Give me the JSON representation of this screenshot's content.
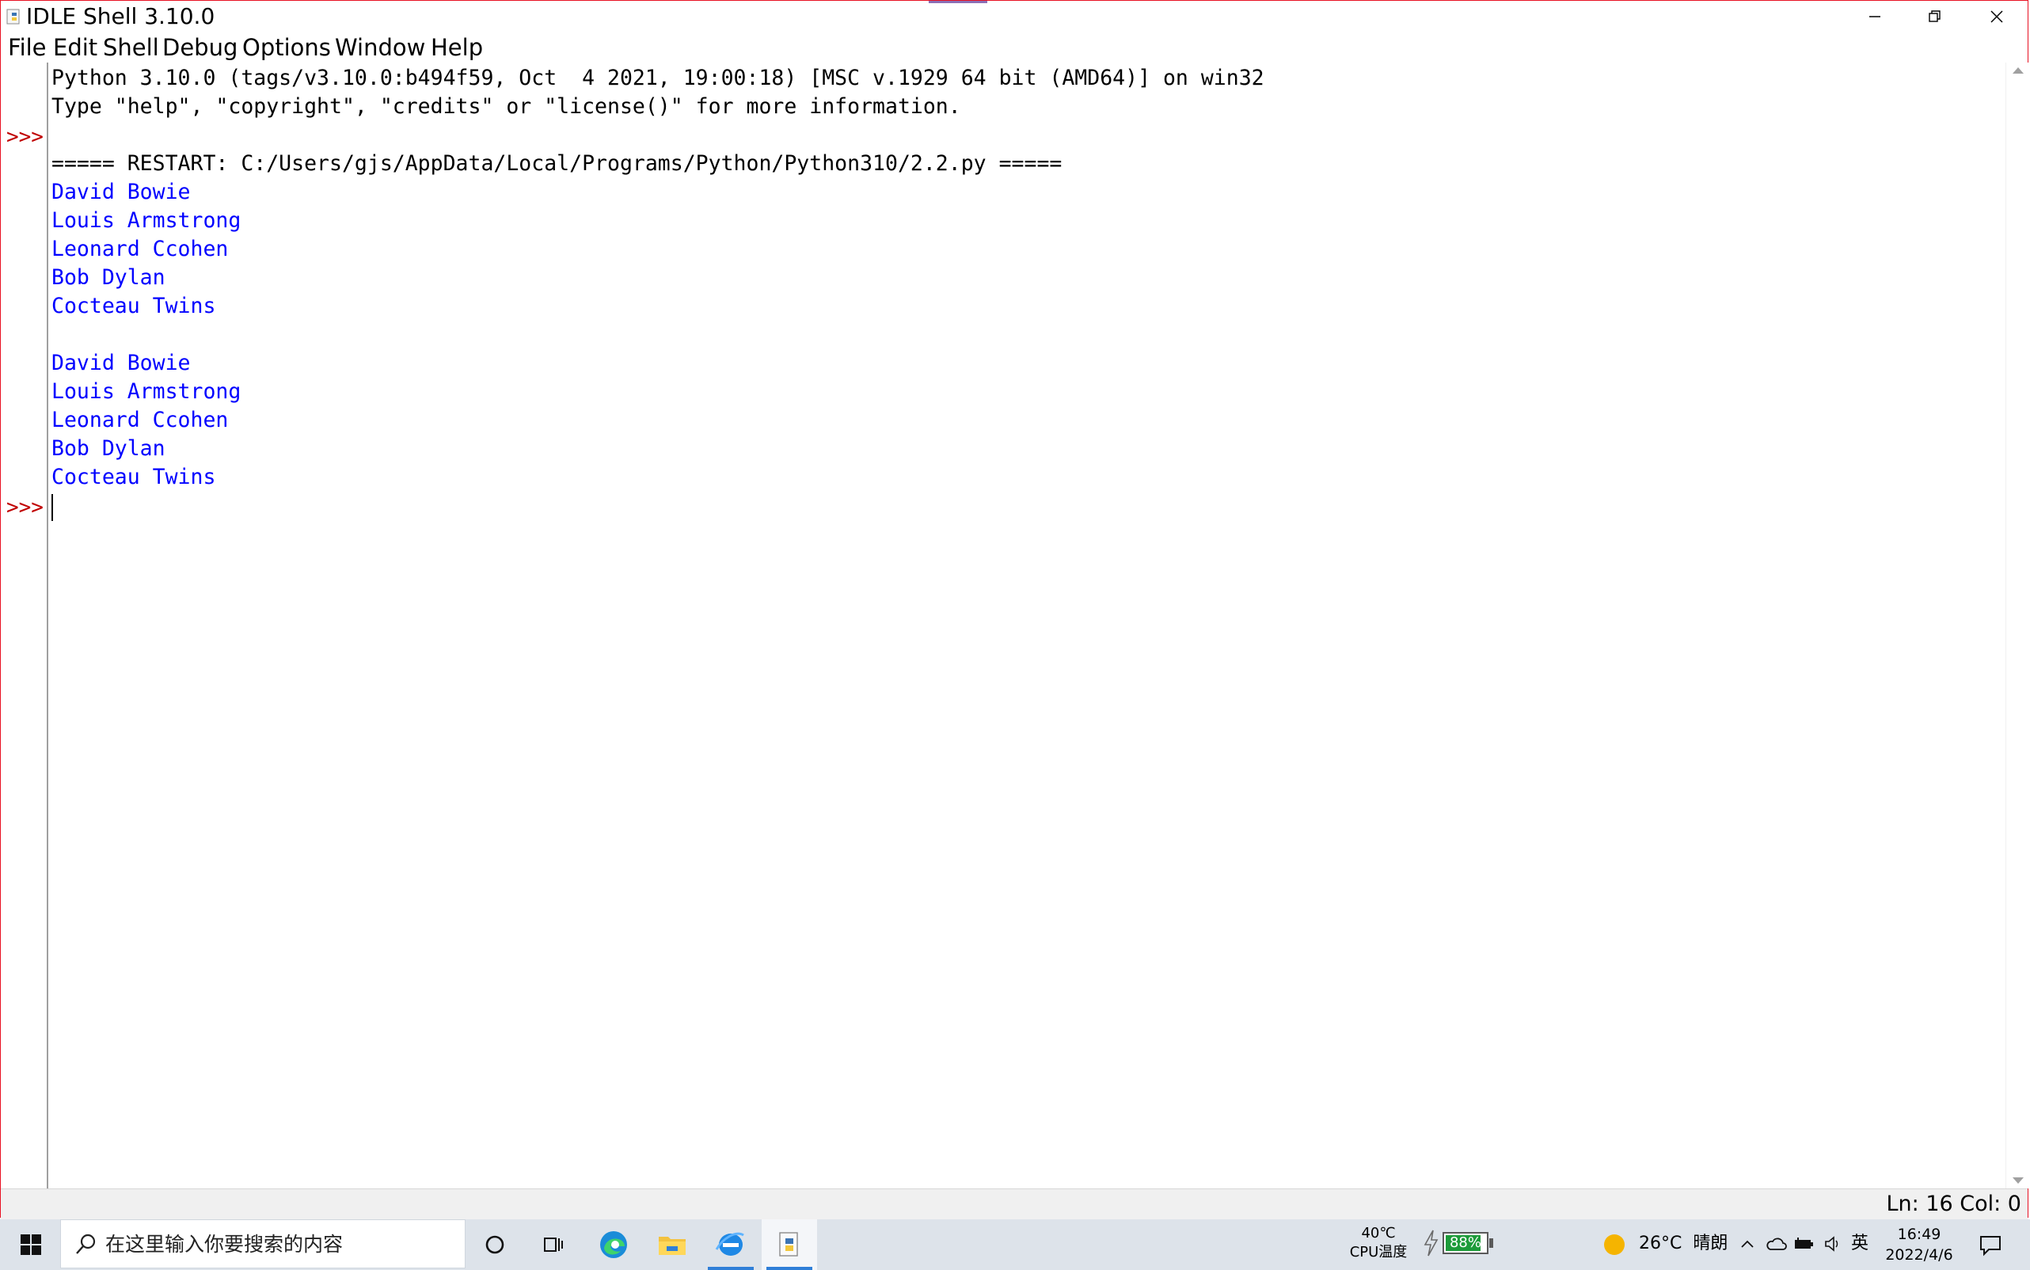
{
  "window": {
    "title": "IDLE Shell 3.10.0",
    "border_color": "#e81123"
  },
  "menu": [
    "File",
    "Edit",
    "Shell",
    "Debug",
    "Options",
    "Window",
    "Help"
  ],
  "gutter": {
    "prompt": ">>>"
  },
  "shell": {
    "banner_line1": "Python 3.10.0 (tags/v3.10.0:b494f59, Oct  4 2021, 19:00:18) [MSC v.1929 64 bit (AMD64)] on win32",
    "banner_line2": "Type \"help\", \"copyright\", \"credits\" or \"license()\" for more information.",
    "restart_line": "===== RESTART: C:/Users/gjs/AppData/Local/Programs/Python/Python310/2.2.py =====",
    "output_block_1": [
      "David Bowie",
      "Louis Armstrong",
      "Leonard Ccohen",
      "Bob Dylan",
      "Cocteau Twins"
    ],
    "output_block_2": [
      "David Bowie",
      "Louis Armstrong",
      "Leonard Ccohen",
      "Bob Dylan",
      "Cocteau Twins"
    ],
    "output_color": "#0000ff",
    "prompt_color": "#c00000"
  },
  "status": {
    "position": "Ln: 16 Col: 0"
  },
  "taskbar": {
    "search_placeholder": "在这里输入你要搜索的内容",
    "cpu_temp": "40℃",
    "cpu_label": "CPU温度",
    "battery": "88%",
    "battery_level": 0.88,
    "weather_temp": "26°C",
    "weather_desc": "晴朗",
    "ime": "英",
    "time": "16:49",
    "date": "2022/4/6"
  }
}
